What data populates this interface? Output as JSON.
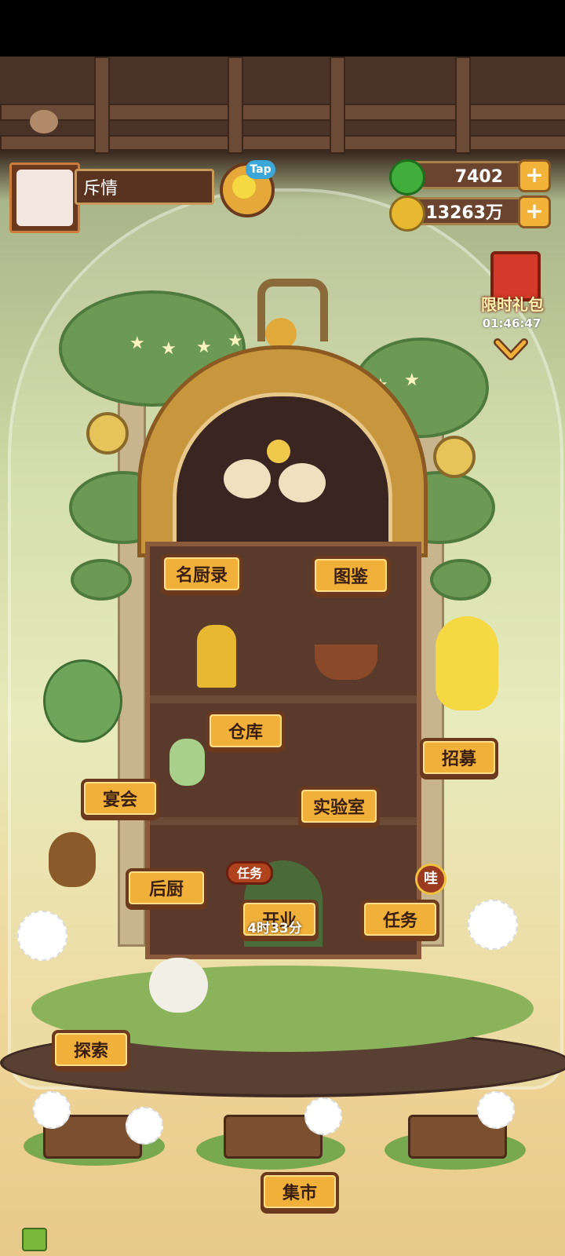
{
  "player": {
    "name": "斥情"
  },
  "tap": {
    "label": "Tap"
  },
  "resources": [
    {
      "icon": "green-jade-icon",
      "value": "7402",
      "color": "#3fae3a"
    },
    {
      "icon": "gold-coin-icon",
      "value": "13263万",
      "color": "#e8b830"
    }
  ],
  "gift": {
    "label": "限时礼包",
    "timer": "01:46:47"
  },
  "buttons": {
    "chef_records": "名厨录",
    "atlas": "图鉴",
    "warehouse": "仓库",
    "recruit": "招募",
    "banquet": "宴会",
    "lab": "实验室",
    "kitchen": "后厨",
    "open_business": "开业",
    "tasks": "任务",
    "explore": "探索",
    "market": "集市"
  },
  "business": {
    "tag": "任务",
    "countdown": "4时33分"
  },
  "tasks_badge": "哇",
  "colors": {
    "button_fill": "#f0b03a",
    "button_border": "#6b3a1e",
    "accent_red": "#b0421e"
  }
}
